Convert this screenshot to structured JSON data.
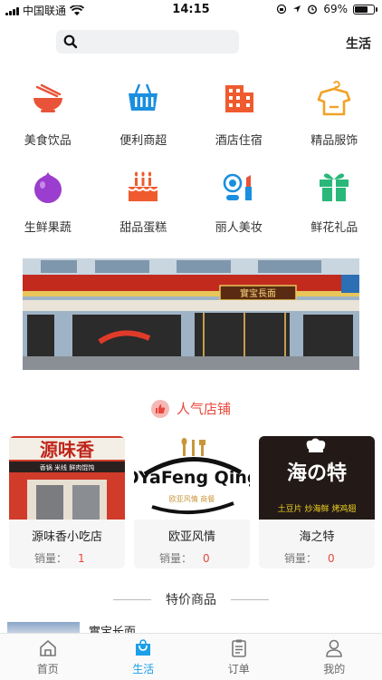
{
  "status_bar": {
    "carrier": "中国联通",
    "time": "14:15",
    "battery": "69%",
    "battery_level": 0.69
  },
  "header": {
    "search_placeholder": "",
    "city": "生活"
  },
  "categories": [
    {
      "label": "美食饮品",
      "icon": "food-bowl-icon",
      "color": "#e8533a"
    },
    {
      "label": "便利商超",
      "icon": "shopping-basket-icon",
      "color": "#1a8fe0"
    },
    {
      "label": "酒店住宿",
      "icon": "hotel-building-icon",
      "color": "#ef5b2f"
    },
    {
      "label": "精品服饰",
      "icon": "shirt-icon",
      "color": "#f2a227"
    },
    {
      "label": "生鲜果蔬",
      "icon": "fruit-icon",
      "color": "#9b3dce"
    },
    {
      "label": "甜品蛋糕",
      "icon": "cake-icon",
      "color": "#ef5b2f"
    },
    {
      "label": "丽人美妆",
      "icon": "makeup-icon",
      "color": "#1a8fe0"
    },
    {
      "label": "鲜花礼品",
      "icon": "gift-icon",
      "color": "#2ab87a"
    }
  ],
  "banner": {
    "sign_text": "實宝長面"
  },
  "popular_shops": {
    "title": "人气店铺",
    "sales_label": "销量：",
    "items": [
      {
        "name": "源味香小吃店",
        "sales": "1",
        "logo_text": "源味香",
        "logo_sub": "香锅 米线 鲜肉馄饨"
      },
      {
        "name": "欧亚风情",
        "sales": "0",
        "logo_text": "OYaFeng Qing",
        "logo_sub": "欧亚风情 商餐"
      },
      {
        "name": "海之特",
        "sales": "0",
        "logo_text": "海の特",
        "logo_sub": "土豆片 炒海鲜 烤鸡翅"
      }
    ]
  },
  "special_products": {
    "title": "特价商品",
    "first_item": "實宝长面"
  },
  "tabbar": [
    {
      "label": "首页",
      "icon": "home-icon",
      "active": false
    },
    {
      "label": "生活",
      "icon": "shopping-bag-icon",
      "active": true
    },
    {
      "label": "订单",
      "icon": "order-clipboard-icon",
      "active": false
    },
    {
      "label": "我的",
      "icon": "user-icon",
      "active": false
    }
  ],
  "colors": {
    "accent": "#1aa0e8",
    "hot": "#e8473d"
  }
}
